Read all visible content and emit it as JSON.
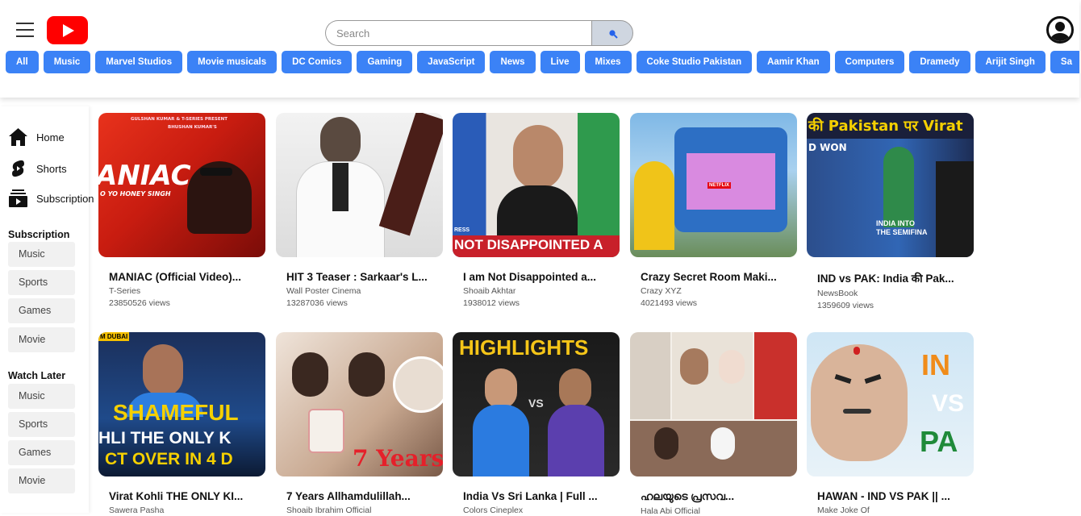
{
  "header": {
    "search_placeholder": "Search",
    "chips": [
      "All",
      "Music",
      "Marvel Studios",
      "Movie musicals",
      "DC Comics",
      "Gaming",
      "JavaScript",
      "News",
      "Live",
      "Mixes",
      "Coke Studio Pakistan",
      "Aamir Khan",
      "Computers",
      "Dramedy",
      "Arijit Singh",
      "Sa"
    ]
  },
  "sidebar": {
    "nav": [
      {
        "label": "Home",
        "icon": "home-icon"
      },
      {
        "label": "Shorts",
        "icon": "shorts-icon"
      },
      {
        "label": "Subscription",
        "icon": "subscription-icon"
      }
    ],
    "subscription_title": "Subscription",
    "subscription_items": [
      "Music",
      "Sports",
      "Games",
      "Movie"
    ],
    "watch_later_title": "Watch Later",
    "watch_later_items": [
      "Music",
      "Sports",
      "Games",
      "Movie"
    ]
  },
  "videos": [
    {
      "title": "MANIAC (Official Video)...",
      "channel": "T-Series",
      "views": "23850526 views",
      "thumb_text": [
        "GULSHAN KUMAR & T-SERIES PRESENT",
        "BHUSHAN KUMAR'S",
        "ANIAC",
        "O YO HONEY SINGH"
      ]
    },
    {
      "title": "HIT 3 Teaser : Sarkaar's L...",
      "channel": "Wall Poster Cinema",
      "views": "13287036 views",
      "thumb_text": []
    },
    {
      "title": "I am Not Disappointed a...",
      "channel": "Shoaib Akhtar",
      "views": "1938012 views",
      "thumb_text": [
        "NOT DISAPPOINTED A",
        "RESS"
      ]
    },
    {
      "title": "Crazy Secret Room Maki...",
      "channel": "Crazy XYZ",
      "views": "4021493 views",
      "thumb_text": [
        "NETFLIX"
      ]
    },
    {
      "title": "IND vs PAK: India की Pak...",
      "channel": "NewsBook",
      "views": "1359609 views",
      "thumb_text": [
        "की Pakistan पर Virat",
        "D WON",
        "INDIA INTO",
        "THE SEMIFINA"
      ]
    },
    {
      "title": "Virat Kohli THE ONLY KI...",
      "channel": "Sawera Pasha",
      "views": "",
      "thumb_text": [
        "M DUBAI",
        "SHAMEFUL",
        "HLI THE ONLY K",
        "CT OVER IN 4 D"
      ]
    },
    {
      "title": "7 Years Allhamdulillah...",
      "channel": "Shoaib Ibrahim Official",
      "views": "",
      "thumb_text": [
        "7 Years"
      ]
    },
    {
      "title": "India Vs Sri Lanka | Full ...",
      "channel": "Colors Cineplex",
      "views": "",
      "thumb_text": [
        "HIGHLIGHTS",
        "VS"
      ]
    },
    {
      "title": "ഹലയുടെ പ്രസവ...",
      "channel": "Hala Abi Official",
      "views": "",
      "thumb_text": []
    },
    {
      "title": "HAWAN - IND VS PAK || ...",
      "channel": "Make Joke Of",
      "views": "",
      "thumb_text": [
        "IN",
        "VS",
        "PA"
      ]
    }
  ],
  "colors": {
    "chip": "#3b82f6",
    "logo": "#ff0000"
  }
}
